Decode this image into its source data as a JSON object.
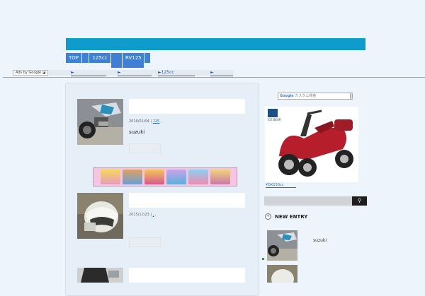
{
  "nav": {
    "items": [
      {
        "label": "TOP",
        "name": "nav-top"
      },
      {
        "label": "",
        "name": "nav-item-2"
      },
      {
        "label": "125cc",
        "name": "nav-125cc"
      },
      {
        "label": "",
        "name": "nav-item-4"
      },
      {
        "label": "RV125",
        "name": "nav-rv125"
      },
      {
        "label": "",
        "name": "nav-item-6"
      }
    ]
  },
  "ads": {
    "badge": "Ads by Google",
    "links": [
      "►",
      "►",
      "►125cc",
      "►"
    ]
  },
  "posts": [
    {
      "date": "2016/01/04 |",
      "category": "125",
      "category_suffix": ",",
      "excerpt": "suzuki"
    },
    {
      "date": "2015/12/23 |",
      "category": ",",
      "category_suffix": ",",
      "excerpt": ""
    }
  ],
  "sidebar": {
    "search_google": "Google",
    "search_placeholder": "カスタム検索",
    "scooter_link": "¥OK150cc",
    "search_button": "⚲",
    "new_entry_title": "NEW ENTRY",
    "new_entry_items": [
      "suzuki"
    ]
  },
  "colors": {
    "header": "#0d9ccc",
    "nav": "#3f7fd6",
    "background": "#eef4fb"
  }
}
